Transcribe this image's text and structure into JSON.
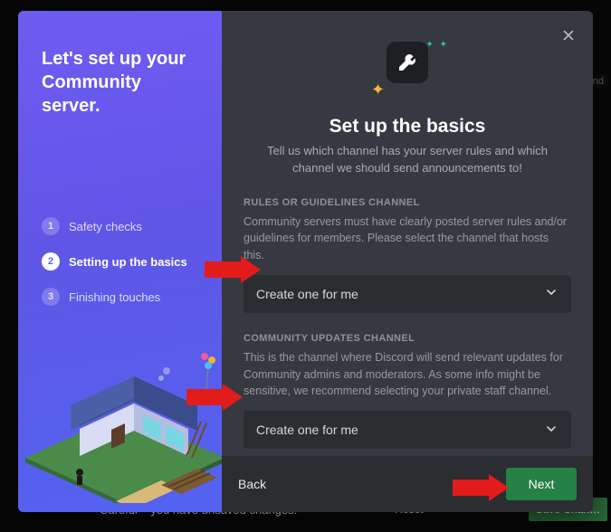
{
  "background": {
    "unsaved_msg": "Careful – you have unsaved changes!",
    "reset_label": "Reset",
    "save_label": "Save Chan…",
    "chip_right": "flegend"
  },
  "sidebar": {
    "title": "Let's set up your Community server.",
    "steps": [
      {
        "num": "1",
        "label": "Safety checks"
      },
      {
        "num": "2",
        "label": "Setting up the basics"
      },
      {
        "num": "3",
        "label": "Finishing touches"
      }
    ],
    "active_index": 1
  },
  "main": {
    "heading": "Set up the basics",
    "subtitle": "Tell us which channel has your server rules and which channel we should send announcements to!",
    "sections": [
      {
        "label": "RULES OR GUIDELINES CHANNEL",
        "desc": "Community servers must have clearly posted server rules and/or guidelines for members. Please select the channel that hosts this.",
        "select_value": "Create one for me"
      },
      {
        "label": "COMMUNITY UPDATES CHANNEL",
        "desc": "This is the channel where Discord will send relevant updates for Community admins and moderators. As some info might be sensitive, we recommend selecting your private staff channel.",
        "select_value": "Create one for me"
      }
    ]
  },
  "footer": {
    "back_label": "Back",
    "next_label": "Next"
  },
  "colors": {
    "accent_purple": "#5865f2",
    "accent_green": "#248045",
    "panel_dark": "#36393f"
  }
}
